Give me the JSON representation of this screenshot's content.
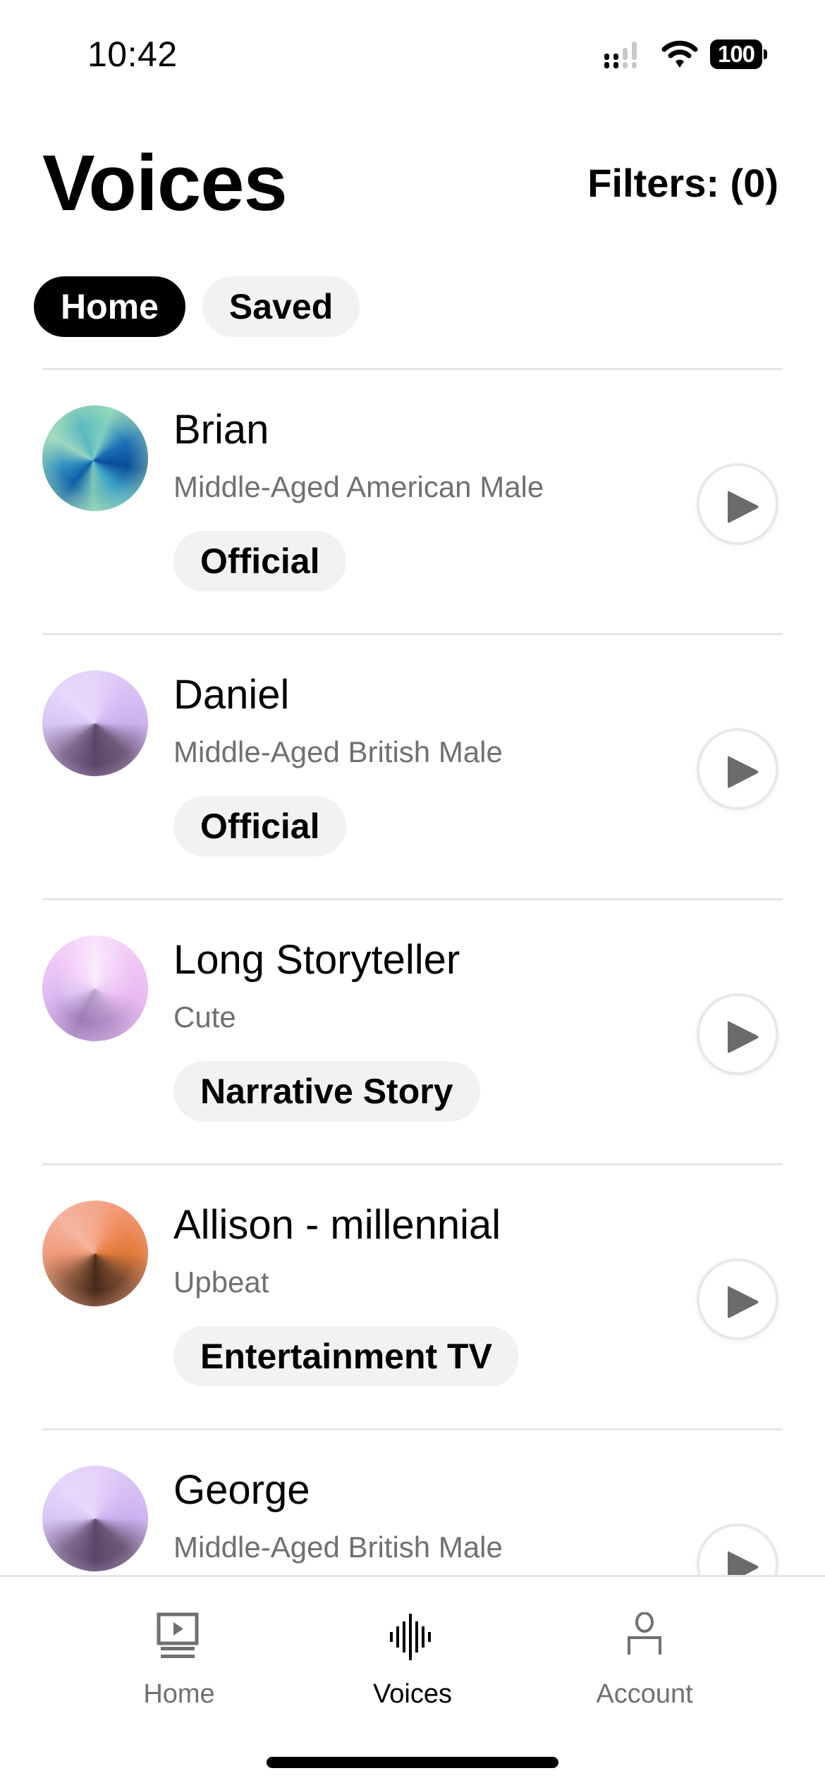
{
  "status_bar": {
    "time": "10:42",
    "battery_level": "100",
    "signal_icon": "cellular-signal-icon",
    "wifi_icon": "wifi-icon"
  },
  "header": {
    "title": "Voices",
    "filters_label": "Filters: (0)"
  },
  "tabs": [
    {
      "label": "Home",
      "active": true
    },
    {
      "label": "Saved",
      "active": false
    }
  ],
  "voices": [
    {
      "name": "Brian",
      "description": "Middle-Aged American Male",
      "tag": "Official",
      "avatar_style": "blue-green"
    },
    {
      "name": "Daniel",
      "description": "Middle-Aged British Male",
      "tag": "Official",
      "avatar_style": "purple"
    },
    {
      "name": "Long Storyteller",
      "description": "Cute",
      "tag": "Narrative Story",
      "avatar_style": "pink"
    },
    {
      "name": "Allison - millennial",
      "description": "Upbeat",
      "tag": "Entertainment TV",
      "avatar_style": "orange"
    },
    {
      "name": "George",
      "description": "Middle-Aged British Male",
      "tag": "",
      "avatar_style": "purple"
    }
  ],
  "bottom_nav": {
    "items": [
      {
        "label": "Home",
        "icon": "video-library-icon",
        "active": false
      },
      {
        "label": "Voices",
        "icon": "waveform-icon",
        "active": true
      },
      {
        "label": "Account",
        "icon": "person-icon",
        "active": false
      }
    ]
  },
  "colors": {
    "accent": "#000000",
    "secondary_text": "#707070",
    "chip_background": "#f2f2f2",
    "divider": "#e6e6e6",
    "play_icon": "#6b6b6b"
  }
}
